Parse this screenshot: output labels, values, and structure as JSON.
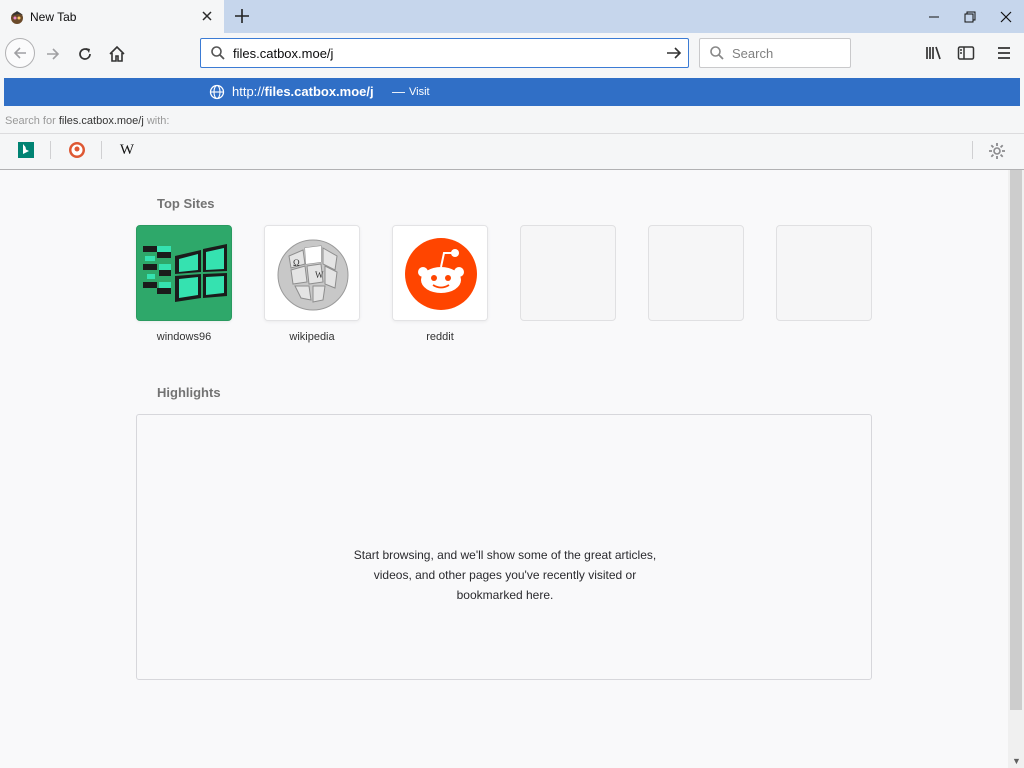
{
  "window": {
    "tab_title": "New Tab",
    "tab_favicon": "firefox-favicon"
  },
  "navbar": {
    "url_value": "files.catbox.moe/j",
    "search_placeholder": "Search"
  },
  "suggestion": {
    "url_prefix": "http://",
    "url_host": "files.catbox.moe/j",
    "dash": "—",
    "visit_label": "Visit"
  },
  "search_with": {
    "prefix": "Search for",
    "query": "files.catbox.moe/j",
    "suffix": "with:"
  },
  "engines": [
    "bing-icon",
    "duckduckgo-icon",
    "wikipedia-icon"
  ],
  "engine_wiki_glyph": "W",
  "top_sites": {
    "title": "Top Sites",
    "tiles": [
      {
        "label": "windows96"
      },
      {
        "label": "wikipedia"
      },
      {
        "label": "reddit"
      },
      {
        "label": ""
      },
      {
        "label": ""
      },
      {
        "label": ""
      }
    ]
  },
  "highlights": {
    "title": "Highlights",
    "message_lines": [
      "Start browsing, and we'll show some of the great articles,",
      "videos, and other pages you've recently visited or",
      "bookmarked here."
    ]
  },
  "colors": {
    "accent": "#306fc6",
    "reddit": "#ff4500",
    "windows96_bg": "#2ea86a"
  }
}
